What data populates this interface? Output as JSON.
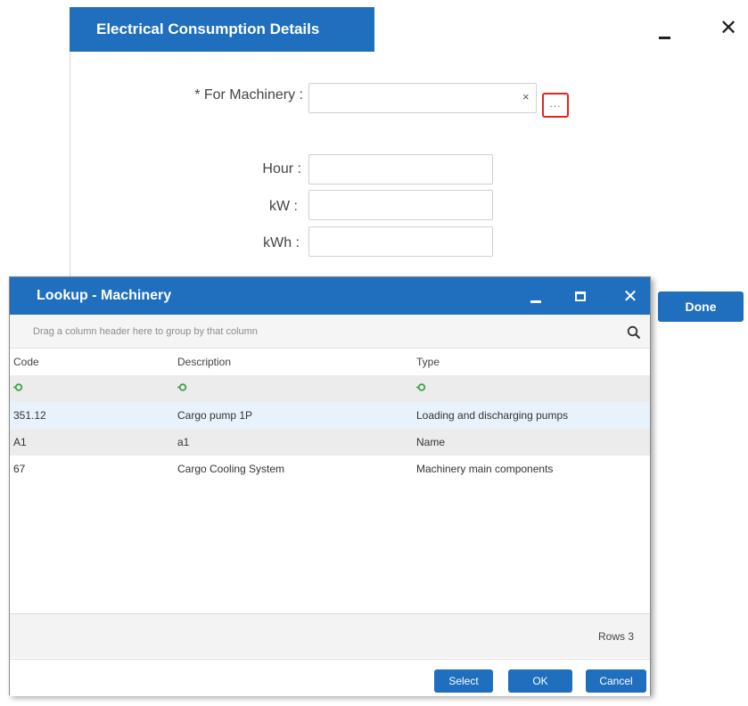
{
  "main_dialog": {
    "title": "Electrical Consumption Details",
    "close_glyph": "✕",
    "fields": {
      "machinery_label": "* For Machinery :",
      "machinery_value": "",
      "clear_glyph": "×",
      "ellipsis": "...",
      "hour_label": "Hour :",
      "hour_value": "",
      "kw_label": "kW :",
      "kw_value": "",
      "kwh_label": "kWh :",
      "kwh_value": ""
    },
    "done_label": "Done"
  },
  "lookup": {
    "title": "Lookup - Machinery",
    "close_glyph": "✕",
    "group_hint": "Drag a column header here to group by that column",
    "columns": [
      "Code",
      "Description",
      "Type"
    ],
    "rows": [
      {
        "code": "351.12",
        "description": "Cargo pump 1P",
        "type": "Loading and discharging pumps"
      },
      {
        "code": "A1",
        "description": "a1",
        "type": "Name"
      },
      {
        "code": "67",
        "description": "Cargo Cooling System",
        "type": "Machinery main components"
      }
    ],
    "rows_count": "Rows 3",
    "buttons": {
      "select": "Select",
      "ok": "OK",
      "cancel": "Cancel"
    }
  },
  "colors": {
    "accent": "#1f6fbe",
    "highlight_border": "#e32424",
    "selected_row": "#e8f2fb",
    "filter_icon": "#3aa34a"
  }
}
